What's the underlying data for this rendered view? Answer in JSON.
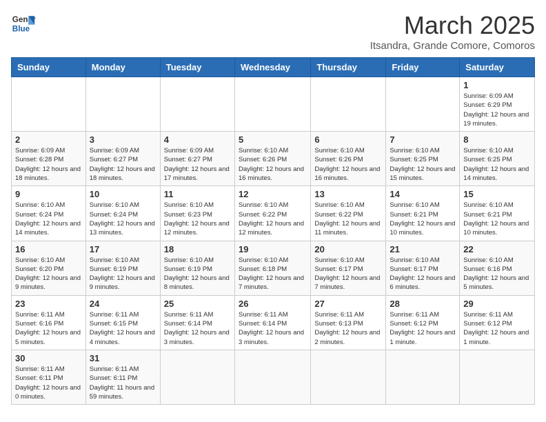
{
  "header": {
    "logo_line1": "General",
    "logo_line2": "Blue",
    "month_title": "March 2025",
    "location": "Itsandra, Grande Comore, Comoros"
  },
  "weekdays": [
    "Sunday",
    "Monday",
    "Tuesday",
    "Wednesday",
    "Thursday",
    "Friday",
    "Saturday"
  ],
  "weeks": [
    [
      {
        "day": "",
        "info": ""
      },
      {
        "day": "",
        "info": ""
      },
      {
        "day": "",
        "info": ""
      },
      {
        "day": "",
        "info": ""
      },
      {
        "day": "",
        "info": ""
      },
      {
        "day": "",
        "info": ""
      },
      {
        "day": "1",
        "info": "Sunrise: 6:09 AM\nSunset: 6:29 PM\nDaylight: 12 hours and 19 minutes."
      }
    ],
    [
      {
        "day": "2",
        "info": "Sunrise: 6:09 AM\nSunset: 6:28 PM\nDaylight: 12 hours and 18 minutes."
      },
      {
        "day": "3",
        "info": "Sunrise: 6:09 AM\nSunset: 6:27 PM\nDaylight: 12 hours and 18 minutes."
      },
      {
        "day": "4",
        "info": "Sunrise: 6:09 AM\nSunset: 6:27 PM\nDaylight: 12 hours and 17 minutes."
      },
      {
        "day": "5",
        "info": "Sunrise: 6:10 AM\nSunset: 6:26 PM\nDaylight: 12 hours and 16 minutes."
      },
      {
        "day": "6",
        "info": "Sunrise: 6:10 AM\nSunset: 6:26 PM\nDaylight: 12 hours and 16 minutes."
      },
      {
        "day": "7",
        "info": "Sunrise: 6:10 AM\nSunset: 6:25 PM\nDaylight: 12 hours and 15 minutes."
      },
      {
        "day": "8",
        "info": "Sunrise: 6:10 AM\nSunset: 6:25 PM\nDaylight: 12 hours and 14 minutes."
      }
    ],
    [
      {
        "day": "9",
        "info": "Sunrise: 6:10 AM\nSunset: 6:24 PM\nDaylight: 12 hours and 14 minutes."
      },
      {
        "day": "10",
        "info": "Sunrise: 6:10 AM\nSunset: 6:24 PM\nDaylight: 12 hours and 13 minutes."
      },
      {
        "day": "11",
        "info": "Sunrise: 6:10 AM\nSunset: 6:23 PM\nDaylight: 12 hours and 12 minutes."
      },
      {
        "day": "12",
        "info": "Sunrise: 6:10 AM\nSunset: 6:22 PM\nDaylight: 12 hours and 12 minutes."
      },
      {
        "day": "13",
        "info": "Sunrise: 6:10 AM\nSunset: 6:22 PM\nDaylight: 12 hours and 11 minutes."
      },
      {
        "day": "14",
        "info": "Sunrise: 6:10 AM\nSunset: 6:21 PM\nDaylight: 12 hours and 10 minutes."
      },
      {
        "day": "15",
        "info": "Sunrise: 6:10 AM\nSunset: 6:21 PM\nDaylight: 12 hours and 10 minutes."
      }
    ],
    [
      {
        "day": "16",
        "info": "Sunrise: 6:10 AM\nSunset: 6:20 PM\nDaylight: 12 hours and 9 minutes."
      },
      {
        "day": "17",
        "info": "Sunrise: 6:10 AM\nSunset: 6:19 PM\nDaylight: 12 hours and 9 minutes."
      },
      {
        "day": "18",
        "info": "Sunrise: 6:10 AM\nSunset: 6:19 PM\nDaylight: 12 hours and 8 minutes."
      },
      {
        "day": "19",
        "info": "Sunrise: 6:10 AM\nSunset: 6:18 PM\nDaylight: 12 hours and 7 minutes."
      },
      {
        "day": "20",
        "info": "Sunrise: 6:10 AM\nSunset: 6:17 PM\nDaylight: 12 hours and 7 minutes."
      },
      {
        "day": "21",
        "info": "Sunrise: 6:10 AM\nSunset: 6:17 PM\nDaylight: 12 hours and 6 minutes."
      },
      {
        "day": "22",
        "info": "Sunrise: 6:10 AM\nSunset: 6:16 PM\nDaylight: 12 hours and 5 minutes."
      }
    ],
    [
      {
        "day": "23",
        "info": "Sunrise: 6:11 AM\nSunset: 6:16 PM\nDaylight: 12 hours and 5 minutes."
      },
      {
        "day": "24",
        "info": "Sunrise: 6:11 AM\nSunset: 6:15 PM\nDaylight: 12 hours and 4 minutes."
      },
      {
        "day": "25",
        "info": "Sunrise: 6:11 AM\nSunset: 6:14 PM\nDaylight: 12 hours and 3 minutes."
      },
      {
        "day": "26",
        "info": "Sunrise: 6:11 AM\nSunset: 6:14 PM\nDaylight: 12 hours and 3 minutes."
      },
      {
        "day": "27",
        "info": "Sunrise: 6:11 AM\nSunset: 6:13 PM\nDaylight: 12 hours and 2 minutes."
      },
      {
        "day": "28",
        "info": "Sunrise: 6:11 AM\nSunset: 6:12 PM\nDaylight: 12 hours and 1 minute."
      },
      {
        "day": "29",
        "info": "Sunrise: 6:11 AM\nSunset: 6:12 PM\nDaylight: 12 hours and 1 minute."
      }
    ],
    [
      {
        "day": "30",
        "info": "Sunrise: 6:11 AM\nSunset: 6:11 PM\nDaylight: 12 hours and 0 minutes."
      },
      {
        "day": "31",
        "info": "Sunrise: 6:11 AM\nSunset: 6:11 PM\nDaylight: 11 hours and 59 minutes."
      },
      {
        "day": "",
        "info": ""
      },
      {
        "day": "",
        "info": ""
      },
      {
        "day": "",
        "info": ""
      },
      {
        "day": "",
        "info": ""
      },
      {
        "day": "",
        "info": ""
      }
    ]
  ]
}
